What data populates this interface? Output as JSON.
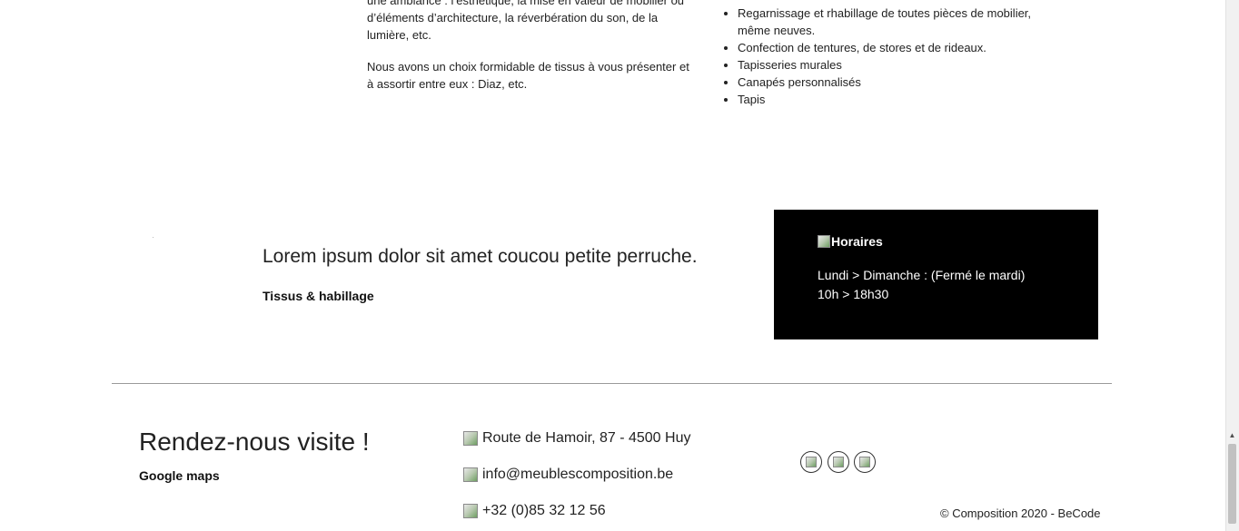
{
  "intro": {
    "paragraph1_lines": [
      "une ambiance : l’esthétique, la mise en valeur de mobilier ou",
      "d’éléments d’architecture, la réverbération du son, de la",
      "lumière, etc."
    ],
    "paragraph2": "Nous avons un choix formidable de tissus à vous présenter et à assortir entre eux : Diaz, etc."
  },
  "services": [
    "Regarnissage et rhabillage de toutes pièces de mobilier, même neuves.",
    "Confection de tentures, de stores et de rideaux.",
    "Tapisseries murales",
    "Canapés personnalisés",
    "Tapis"
  ],
  "feature": {
    "headline": "Lorem ipsum dolor sit amet coucou petite perruche.",
    "subtitle": "Tissus & habillage"
  },
  "hours": {
    "title": "Horaires",
    "days": "Lundi > Dimanche : (Fermé le mardi)",
    "time": "10h > 18h30"
  },
  "footer": {
    "visit_title": "Rendez-nous visite !",
    "maps_link": "Google maps",
    "address": "Route de Hamoir, 87 - 4500 Huy",
    "email": "info@meublescomposition.be",
    "phone": "+32 (0)85 32 12 56",
    "social_icons": [
      "facebook-icon",
      "instagram-icon",
      "twitter-icon"
    ],
    "copyright": "© Composition 2020 - BeCode"
  }
}
